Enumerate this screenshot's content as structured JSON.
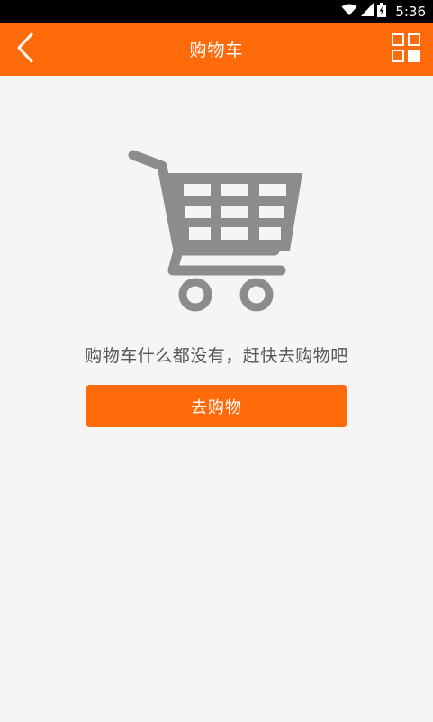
{
  "status_bar": {
    "time": "5:36",
    "icons": [
      "wifi-icon",
      "signal-icon",
      "battery-icon"
    ]
  },
  "app_bar": {
    "title": "购物车",
    "back_icon": "chevron-left-icon",
    "menu_icon": "grid-icon"
  },
  "empty_state": {
    "illustration_icon": "shopping-cart-icon",
    "message": "购物车什么都没有，赶快去购物吧",
    "button_label": "去购物"
  },
  "colors": {
    "brand": "#ff6a0a",
    "background": "#f5f5f5",
    "illustration": "#8c8c8c",
    "text": "#555555"
  }
}
